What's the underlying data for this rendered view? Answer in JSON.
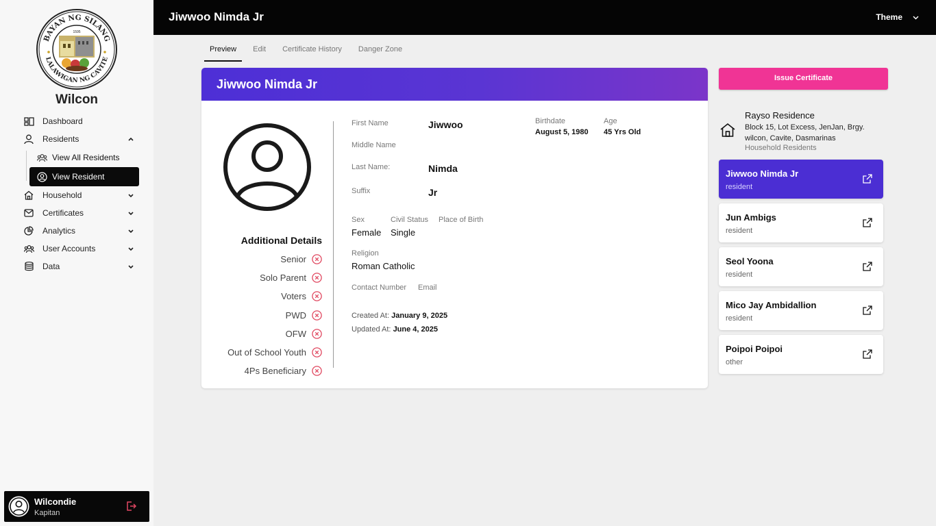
{
  "sidebar": {
    "brand": "Wilcon",
    "logo_text_top": "BAYAN NG SILANG",
    "logo_text_bottom": "LALAWIGAN NG CAVITE",
    "logo_year": "1595",
    "nav": [
      {
        "label": "Dashboard",
        "icon": "dashboard-icon"
      },
      {
        "label": "Residents",
        "icon": "user-icon",
        "expanded": true
      },
      {
        "label": "Household",
        "icon": "home-icon"
      },
      {
        "label": "Certificates",
        "icon": "mail-icon"
      },
      {
        "label": "Analytics",
        "icon": "pie-chart-icon"
      },
      {
        "label": "User Accounts",
        "icon": "users-icon"
      },
      {
        "label": "Data",
        "icon": "database-icon"
      }
    ],
    "residents_sub": [
      {
        "label": "View All Residents",
        "icon": "group-icon"
      },
      {
        "label": "View Resident",
        "icon": "user-circle-icon",
        "active": true
      }
    ],
    "user": {
      "name": "Wilcondie",
      "role": "Kapitan"
    }
  },
  "topbar": {
    "title": "Jiwwoo Nimda Jr",
    "theme_label": "Theme"
  },
  "tabs": [
    {
      "label": "Preview",
      "active": true
    },
    {
      "label": "Edit"
    },
    {
      "label": "Certificate History"
    },
    {
      "label": "Danger Zone"
    }
  ],
  "resident": {
    "full_name": "Jiwwoo Nimda Jr",
    "first_name_label": "First Name",
    "first_name": "Jiwwoo",
    "middle_name_label": "Middle Name",
    "middle_name": "",
    "last_name_label": "Last Name:",
    "last_name": "Nimda",
    "suffix_label": "Suffix",
    "suffix": "Jr",
    "birthdate_label": "Birthdate",
    "birthdate": "August 5, 1980",
    "age_label": "Age",
    "age": "45 Yrs Old",
    "sex_label": "Sex",
    "sex": "Female",
    "civil_status_label": "Civil Status",
    "civil_status": "Single",
    "place_of_birth_label": "Place of Birth",
    "place_of_birth": "",
    "religion_label": "Religion",
    "religion": "Roman Catholic",
    "contact_label": "Contact Number",
    "contact": "",
    "email_label": "Email",
    "email": "",
    "created_label": "Created At:",
    "created": "January 9, 2025",
    "updated_label": "Updated At:",
    "updated": "June 4, 2025"
  },
  "additional_details": {
    "title": "Additional Details",
    "items": [
      {
        "label": "Senior",
        "value": false
      },
      {
        "label": "Solo Parent",
        "value": false
      },
      {
        "label": "Voters",
        "value": false
      },
      {
        "label": "PWD",
        "value": false
      },
      {
        "label": "OFW",
        "value": false
      },
      {
        "label": "Out of School Youth",
        "value": false
      },
      {
        "label": "4Ps Beneficiary",
        "value": false
      }
    ],
    "false_color": "#e0475f"
  },
  "household": {
    "issue_button": "Issue Certificate",
    "name": "Rayso Residence",
    "address": "Block 15, Lot Excess, JenJan, Brgy. wilcon, Cavite, Dasmarinas",
    "subtitle": "Household Residents",
    "members": [
      {
        "name": "Jiwwoo Nimda Jr",
        "role": "resident",
        "active": true
      },
      {
        "name": "Jun Ambigs",
        "role": "resident"
      },
      {
        "name": "Seol Yoona",
        "role": "resident"
      },
      {
        "name": "Mico Jay Ambidallion",
        "role": "resident"
      },
      {
        "name": "Poipoi Poipoi",
        "role": "other"
      }
    ]
  },
  "colors": {
    "accent_purple": "#4b2ed3",
    "accent_pink": "#f03495",
    "topbar": "#050505"
  }
}
